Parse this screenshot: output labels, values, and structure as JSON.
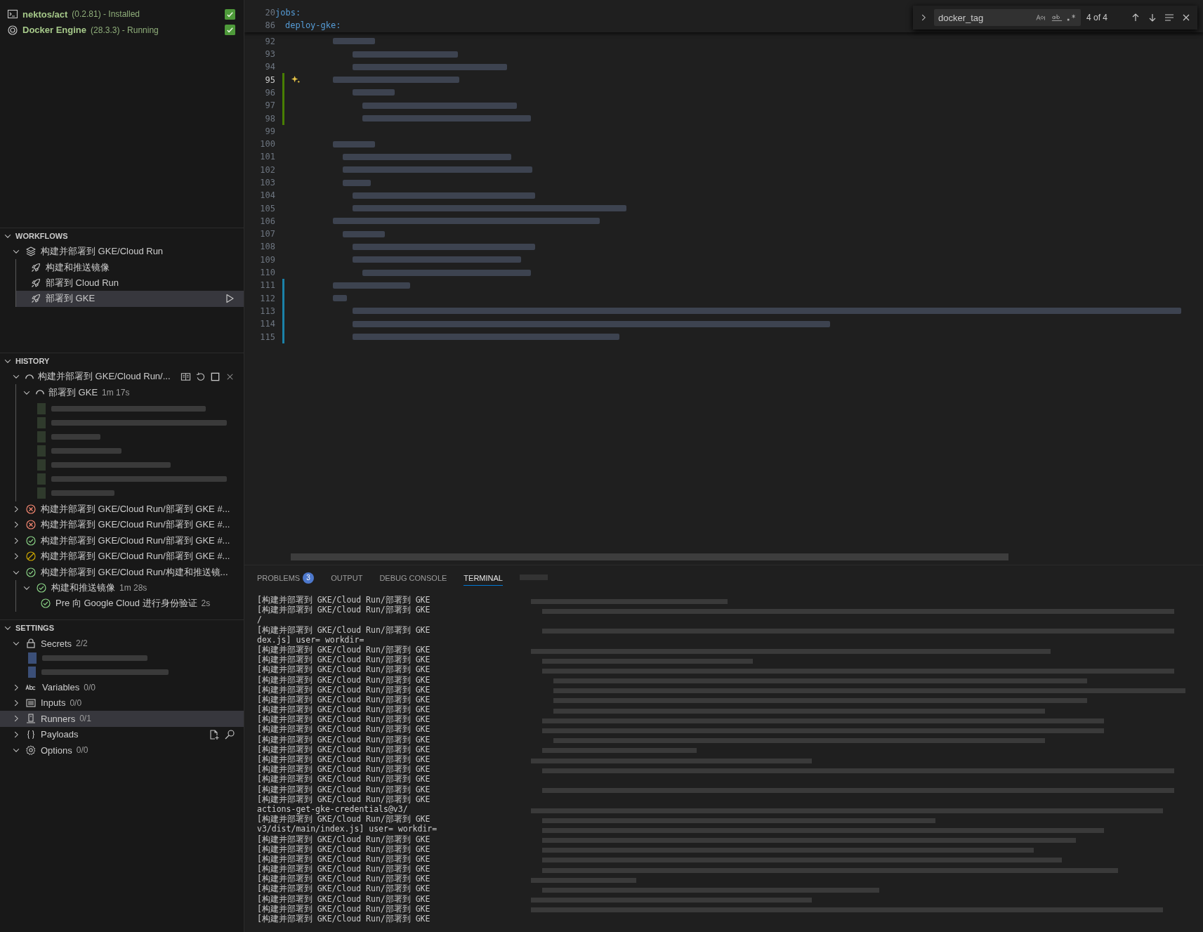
{
  "components": [
    {
      "kind": "terminal",
      "name": "nektos/act",
      "detail": "(0.2.81) - Installed",
      "ok": true
    },
    {
      "kind": "engine",
      "name": "Docker Engine",
      "detail": "(28.3.3) - Running",
      "ok": true
    }
  ],
  "workflows": {
    "title": "WORKFLOWS",
    "expanded": true,
    "items": [
      {
        "label": "构建并部署到 GKE/Cloud Run",
        "expanded": true,
        "children": [
          {
            "label": "构建和推送镜像",
            "selected": false
          },
          {
            "label": "部署到 Cloud Run",
            "selected": false
          },
          {
            "label": "部署到 GKE",
            "selected": true
          }
        ]
      }
    ]
  },
  "history": {
    "title": "HISTORY",
    "expanded": true,
    "runs": [
      {
        "label": "构建并部署到 GKE/Cloud Run/...",
        "kind": "running",
        "expanded": true,
        "actions_visible": true,
        "jobs": [
          {
            "label": "部署到 GKE",
            "duration": "1m 17s",
            "kind": "running",
            "expanded": true,
            "redacted": true
          }
        ]
      },
      {
        "label": "构建并部署到 GKE/Cloud Run/部署到 GKE #...",
        "kind": "failed",
        "expanded": false,
        "actions_visible": false
      },
      {
        "label": "构建并部署到 GKE/Cloud Run/部署到 GKE #...",
        "kind": "failed",
        "expanded": false,
        "actions_visible": false
      },
      {
        "label": "构建并部署到 GKE/Cloud Run/部署到 GKE #...",
        "kind": "success",
        "expanded": false,
        "actions_visible": false
      },
      {
        "label": "构建并部署到 GKE/Cloud Run/部署到 GKE #...",
        "kind": "cancelled",
        "expanded": false,
        "actions_visible": false
      },
      {
        "label": "构建并部署到 GKE/Cloud Run/构建和推送镜...",
        "kind": "success",
        "expanded": true,
        "actions_visible": false,
        "jobs": [
          {
            "label": "构建和推送镜像",
            "duration": "1m 28s",
            "kind": "success",
            "expanded": true,
            "redacted": false,
            "steps": [
              {
                "label": "Pre 向 Google Cloud 进行身份验证",
                "duration": "2s",
                "kind": "success"
              }
            ]
          }
        ]
      }
    ]
  },
  "settings": {
    "title": "SETTINGS",
    "expanded": true,
    "items": [
      {
        "kind": "lock",
        "label": "Secrets",
        "count": "2/2",
        "expanded": true,
        "selected": false,
        "redacted": true,
        "actions_visible": false
      },
      {
        "kind": "abc",
        "label": "Variables",
        "count": "0/0",
        "expanded": false,
        "selected": false,
        "redacted": false,
        "actions_visible": false
      },
      {
        "kind": "list",
        "label": "Inputs",
        "count": "0/0",
        "expanded": false,
        "selected": false,
        "redacted": false,
        "actions_visible": false
      },
      {
        "kind": "runner",
        "label": "Runners",
        "count": "0/1",
        "expanded": false,
        "selected": true,
        "redacted": false,
        "actions_visible": false
      },
      {
        "kind": "braces",
        "label": "Payloads",
        "expanded": false,
        "selected": false,
        "redacted": false,
        "actions_visible": true
      },
      {
        "kind": "gear",
        "label": "Options",
        "count": "0/0",
        "expanded": true,
        "selected": false,
        "redacted": false,
        "actions_visible": false
      }
    ]
  },
  "editor": {
    "sticky_lines": [
      {
        "number": "20",
        "code": "jobs:"
      },
      {
        "number": "86",
        "code": "deploy-gke:"
      }
    ],
    "lines": [
      {
        "number": "92",
        "current": false,
        "kind": "plain"
      },
      {
        "number": "93",
        "current": false,
        "kind": "plain"
      },
      {
        "number": "94",
        "current": false,
        "kind": "plain"
      },
      {
        "number": "95",
        "current": true,
        "kind": "added"
      },
      {
        "number": "96",
        "current": false,
        "kind": "added"
      },
      {
        "number": "97",
        "current": false,
        "kind": "added"
      },
      {
        "number": "98",
        "current": false,
        "kind": "added"
      },
      {
        "number": "99",
        "current": false,
        "kind": "plain"
      },
      {
        "number": "100",
        "current": false,
        "kind": "plain"
      },
      {
        "number": "101",
        "current": false,
        "kind": "plain"
      },
      {
        "number": "102",
        "current": false,
        "kind": "plain"
      },
      {
        "number": "103",
        "current": false,
        "kind": "plain"
      },
      {
        "number": "104",
        "current": false,
        "kind": "plain"
      },
      {
        "number": "105",
        "current": false,
        "kind": "plain"
      },
      {
        "number": "106",
        "current": false,
        "kind": "plain"
      },
      {
        "number": "107",
        "current": false,
        "kind": "plain"
      },
      {
        "number": "108",
        "current": false,
        "kind": "plain"
      },
      {
        "number": "109",
        "current": false,
        "kind": "plain"
      },
      {
        "number": "110",
        "current": false,
        "kind": "plain"
      },
      {
        "number": "111",
        "current": false,
        "kind": "modified"
      },
      {
        "number": "112",
        "current": false,
        "kind": "modified"
      },
      {
        "number": "113",
        "current": false,
        "kind": "modified"
      },
      {
        "number": "114",
        "current": false,
        "kind": "modified"
      },
      {
        "number": "115",
        "current": false,
        "kind": "modified"
      }
    ],
    "find": {
      "query": "docker_tag",
      "result": "4 of 4"
    }
  },
  "panel": {
    "tabs": [
      {
        "label": "PROBLEMS",
        "badge": "3",
        "selected": false
      },
      {
        "label": "OUTPUT",
        "selected": false
      },
      {
        "label": "DEBUG CONSOLE",
        "selected": false
      },
      {
        "label": "TERMINAL",
        "selected": true
      }
    ],
    "terminal_lines": [
      "[构建并部署到 GKE/Cloud Run/部署到 GKE",
      "[构建并部署到 GKE/Cloud Run/部署到 GKE",
      "/",
      "[构建并部署到 GKE/Cloud Run/部署到 GKE",
      "dex.js] user= workdir=",
      "[构建并部署到 GKE/Cloud Run/部署到 GKE",
      "[构建并部署到 GKE/Cloud Run/部署到 GKE",
      "[构建并部署到 GKE/Cloud Run/部署到 GKE",
      "[构建并部署到 GKE/Cloud Run/部署到 GKE",
      "[构建并部署到 GKE/Cloud Run/部署到 GKE",
      "[构建并部署到 GKE/Cloud Run/部署到 GKE",
      "[构建并部署到 GKE/Cloud Run/部署到 GKE",
      "[构建并部署到 GKE/Cloud Run/部署到 GKE",
      "[构建并部署到 GKE/Cloud Run/部署到 GKE",
      "[构建并部署到 GKE/Cloud Run/部署到 GKE",
      "[构建并部署到 GKE/Cloud Run/部署到 GKE",
      "[构建并部署到 GKE/Cloud Run/部署到 GKE",
      "[构建并部署到 GKE/Cloud Run/部署到 GKE",
      "[构建并部署到 GKE/Cloud Run/部署到 GKE",
      "[构建并部署到 GKE/Cloud Run/部署到 GKE",
      "[构建并部署到 GKE/Cloud Run/部署到 GKE",
      "actions-get-gke-credentials@v3/",
      "[构建并部署到 GKE/Cloud Run/部署到 GKE",
      "v3/dist/main/index.js] user= workdir=",
      "[构建并部署到 GKE/Cloud Run/部署到 GKE",
      "[构建并部署到 GKE/Cloud Run/部署到 GKE",
      "[构建并部署到 GKE/Cloud Run/部署到 GKE",
      "[构建并部署到 GKE/Cloud Run/部署到 GKE",
      "[构建并部署到 GKE/Cloud Run/部署到 GKE",
      "[构建并部署到 GKE/Cloud Run/部署到 GKE",
      "[构建并部署到 GKE/Cloud Run/部署到 GKE",
      "[构建并部署到 GKE/Cloud Run/部署到 GKE",
      "[构建并部署到 GKE/Cloud Run/部署到 GKE"
    ]
  }
}
